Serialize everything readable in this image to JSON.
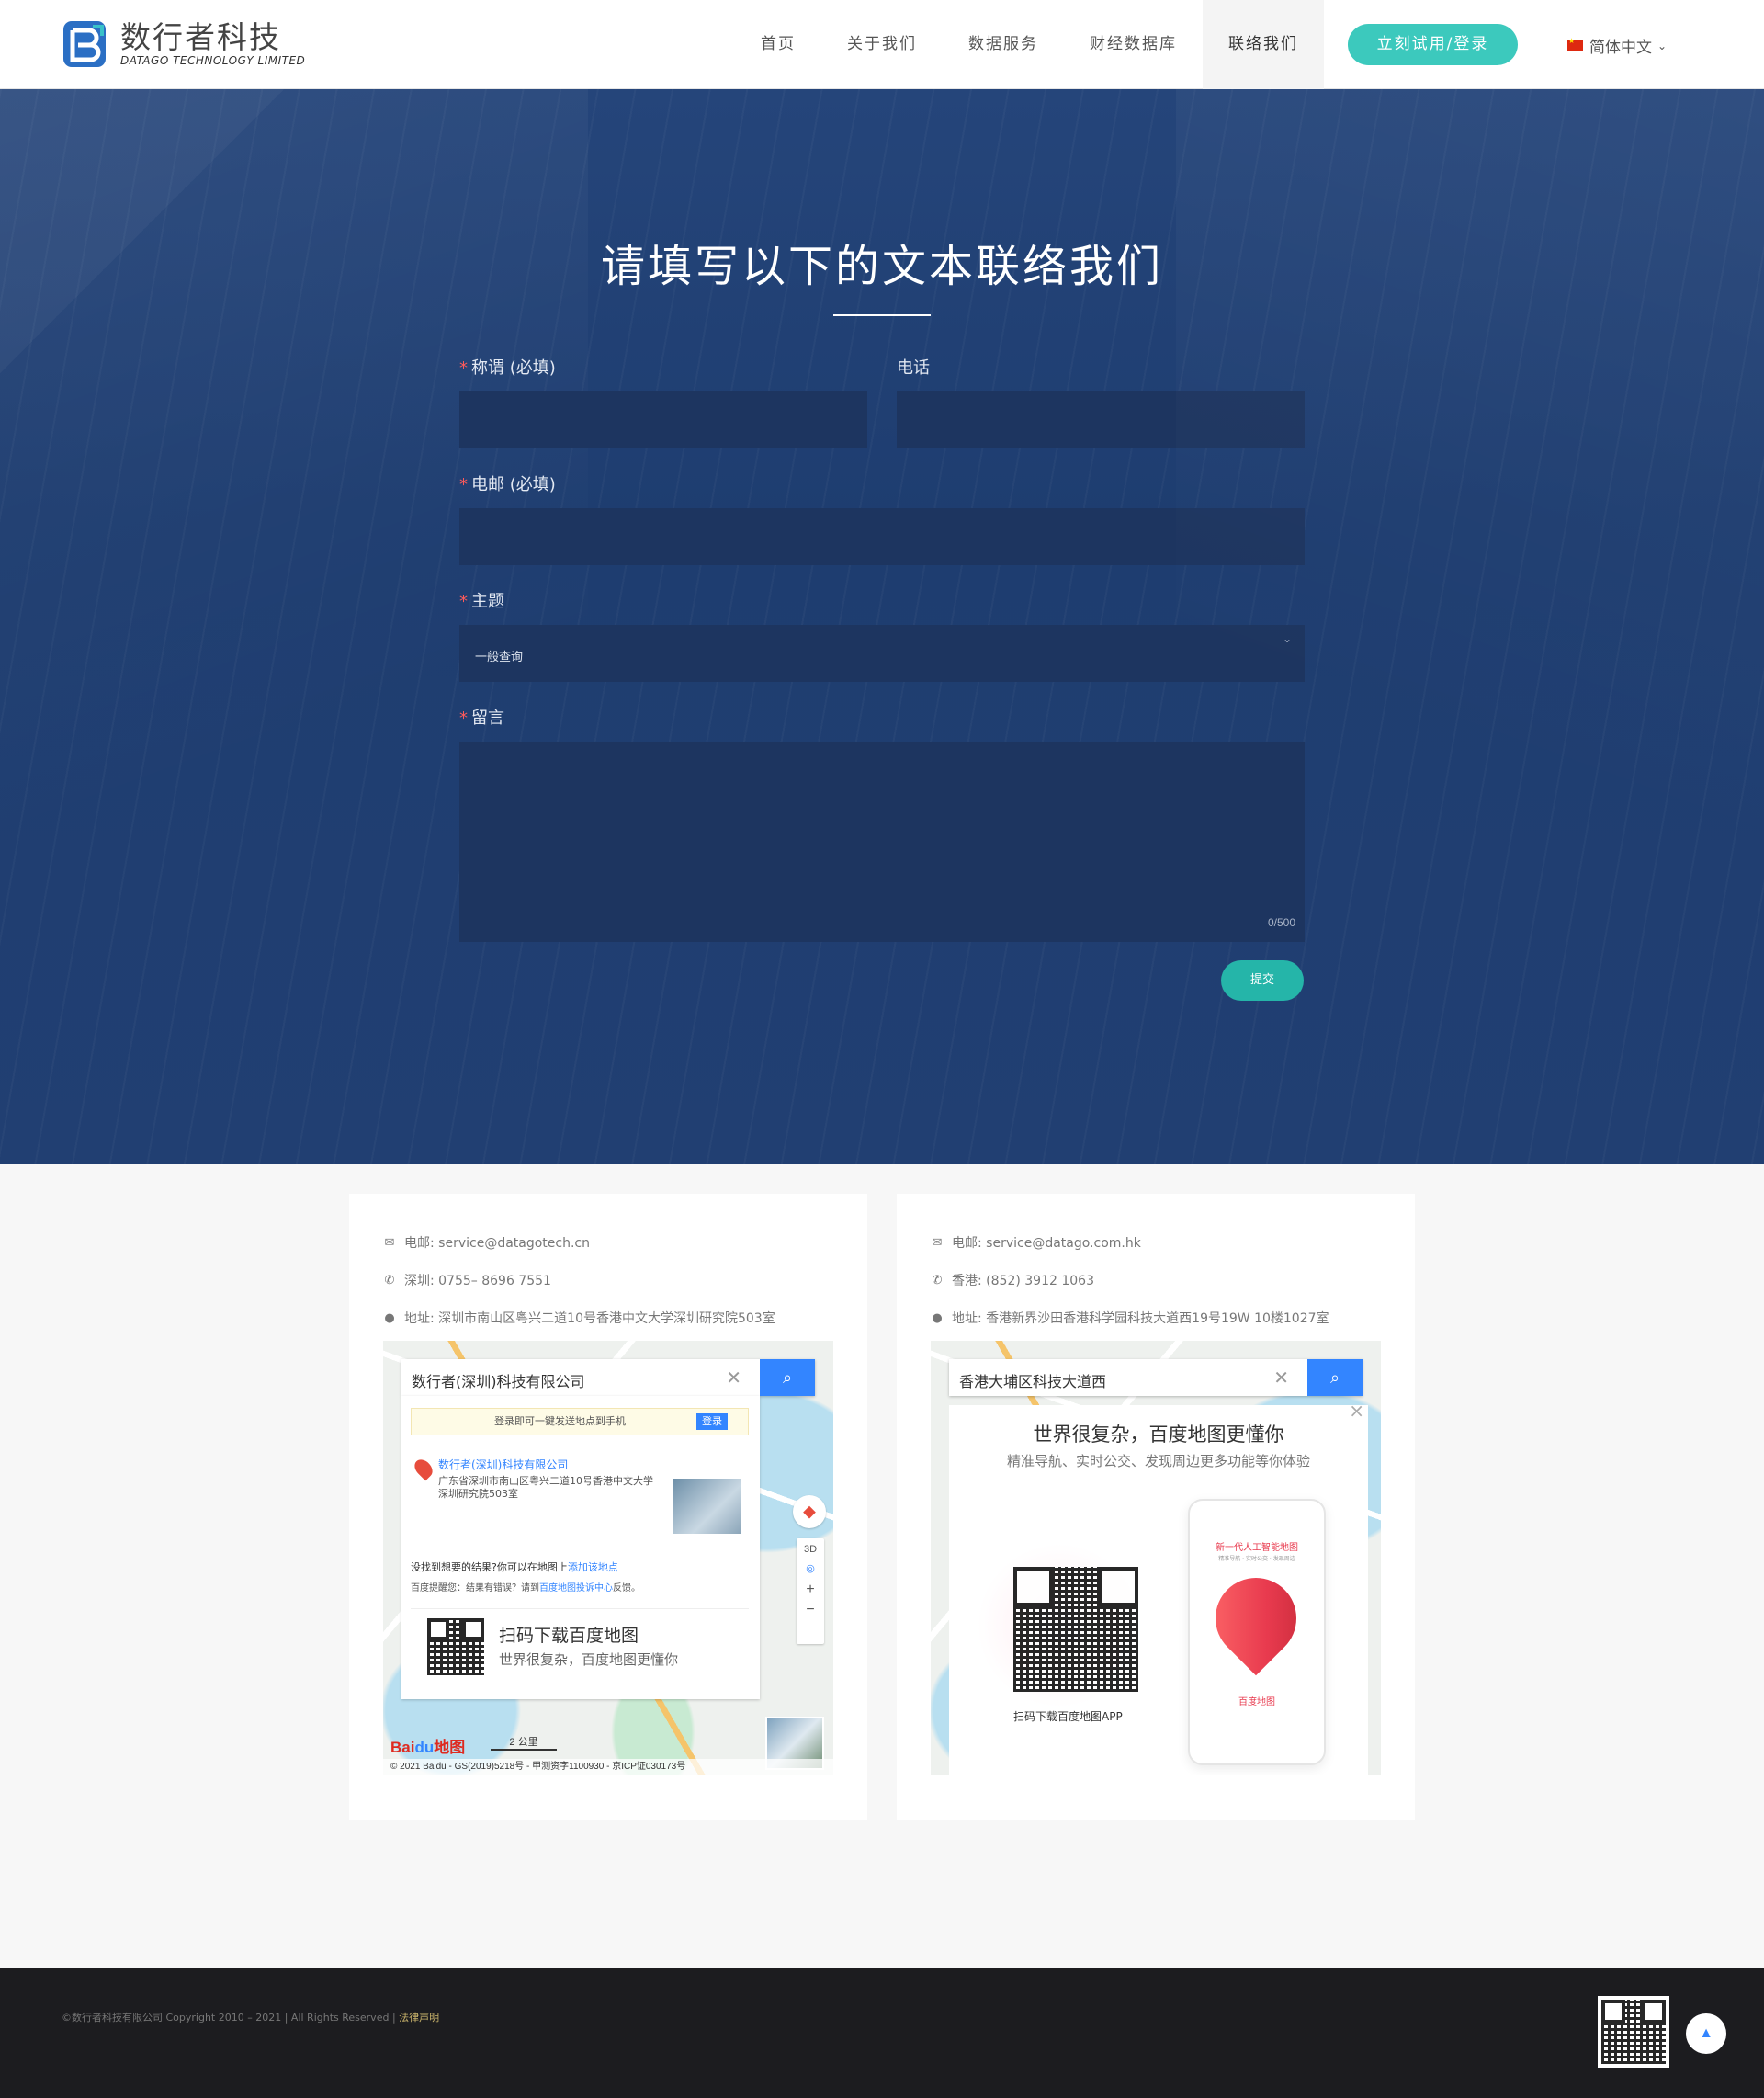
{
  "brand": {
    "name_cn": "数行者科技",
    "name_en": "DATAGO TECHNOLOGY LIMITED"
  },
  "nav": {
    "items": [
      {
        "label": "首页",
        "active": false
      },
      {
        "label": "关于我们",
        "active": false
      },
      {
        "label": "数据服务",
        "active": false
      },
      {
        "label": "财经数据库",
        "active": false
      },
      {
        "label": "联络我们",
        "active": true
      }
    ],
    "cta_label": "立刻试用/登录",
    "language": "简体中文"
  },
  "form": {
    "title": "请填写以下的文本联络我们",
    "name_label": "称谓 (必填)",
    "phone_label": "电话",
    "email_label": "电邮 (必填)",
    "subject_label": "主题",
    "subject_value": "一般查询",
    "message_label": "留言",
    "message_counter": "0/500",
    "submit_label": "提交",
    "required_mark": "*"
  },
  "offices": [
    {
      "email": "电邮: service@datagotech.cn",
      "phone": "深圳: 0755– 8696 7551",
      "address": "地址: 深圳市南山区粤兴二道10号香港中文大学深圳研究院503室",
      "map": {
        "search_text": "数行者(深圳)科技有限公司",
        "login_tip": "登录即可一键发送地点到手机",
        "login_button": "登录",
        "result_name": "数行者(深圳)科技有限公司",
        "result_address": "广东省深圳市南山区粤兴二道10号香港中文大学深圳研究院503室",
        "more_text": "没找到想要的结果?你可以在地图上",
        "more_link": "添加该地点",
        "tip_text": "百度提醒您：结果有错误？请到",
        "tip_link": "百度地图投诉中心",
        "tip_suffix": "反馈。",
        "qr_title": "扫码下载百度地图",
        "qr_sub": "世界很复杂，百度地图更懂你",
        "scale": "2 公里",
        "copyright": "© 2021 Baidu - GS(2019)5218号 - 甲测资字1100930 - 京ICP证030173号",
        "ctrl_3d": "3D"
      }
    },
    {
      "email": "电邮: service@datago.com.hk",
      "phone": "香港: (852) 3912 1063",
      "address": "地址: 香港新界沙田香港科学园科技大道西19号19W 10楼1027室",
      "map": {
        "search_text": "香港大埔区科技大道西",
        "popup_title": "世界很复杂，百度地图更懂你",
        "popup_sub": "精准导航、实时公交、发现周边更多功能等你体验",
        "qr_caption": "扫码下载百度地图APP",
        "phone_title": "新一代人工智能地图",
        "phone_sub": "精准导航 · 实时公交 · 发现周边",
        "phone_brand": "百度地图"
      }
    }
  ],
  "footer": {
    "copyright": "©数行者科技有限公司 Copyright 2010 – 2021 | All Rights Reserved | ",
    "legal_link": "法律声明"
  },
  "colors": {
    "accent": "#3cc9bd",
    "hero_bg": "#213f72",
    "field_bg": "#1d3560",
    "map_blue": "#3385ff"
  }
}
